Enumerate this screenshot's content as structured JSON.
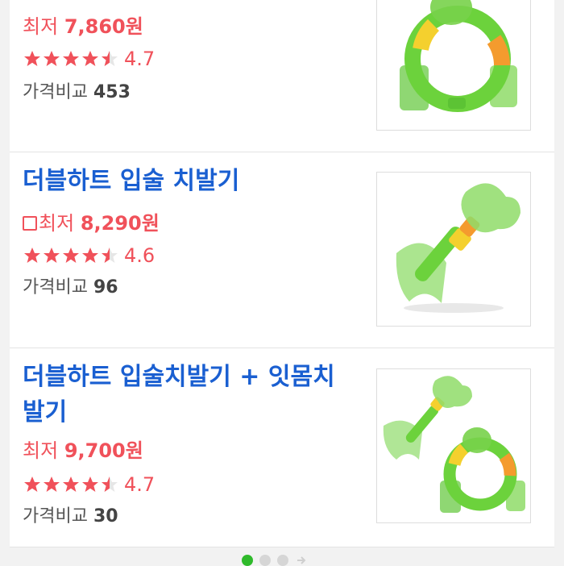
{
  "products": [
    {
      "title": "",
      "price_label": "최저",
      "price": "7,860원",
      "rating": "4.7",
      "compare_label": "가격비교",
      "compare_count": "453",
      "coupon": false
    },
    {
      "title": "더블하트 입술 치발기",
      "price_label": "최저",
      "price": "8,290원",
      "rating": "4.6",
      "compare_label": "가격비교",
      "compare_count": "96",
      "coupon": true
    },
    {
      "title": "더블하트 입술치발기 + 잇몸치발기",
      "price_label": "최저",
      "price": "9,700원",
      "rating": "4.7",
      "compare_label": "가격비교",
      "compare_count": "30",
      "coupon": false
    }
  ],
  "pager": {
    "pages": 3,
    "active_page": 1
  },
  "colors": {
    "title": "#1a5fd1",
    "price": "#f0515a",
    "pager_active": "#2fba2b"
  },
  "icons": [
    "star-icon",
    "half-star-icon",
    "coupon-icon",
    "next-arrow-icon"
  ]
}
